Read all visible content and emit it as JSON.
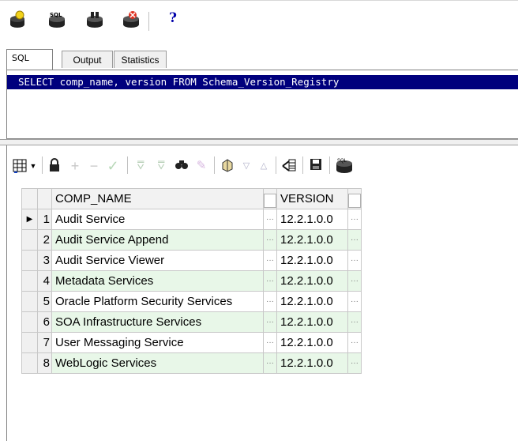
{
  "toolbar": {
    "icons": [
      "connect-icon",
      "sql-icon",
      "execute-icon",
      "disconnect-icon",
      "help-icon"
    ],
    "help_label": "?"
  },
  "tabs": [
    {
      "label": "SQL",
      "active": true
    },
    {
      "label": "Output",
      "active": false
    },
    {
      "label": "Statistics",
      "active": false
    }
  ],
  "editor": {
    "sql": "SELECT comp_name, version  FROM Schema_Version_Registry",
    "selection_color": "#00007d"
  },
  "grid_toolbar": {
    "icons": [
      "grid-view-icon",
      "dropdown-arrow-icon",
      "lock-icon",
      "add-row-icon",
      "delete-row-icon",
      "post-icon",
      "filter-icon",
      "filter-all-icon",
      "find-icon",
      "clear-icon",
      "navigator-icon",
      "sort-desc-icon",
      "sort-asc-icon",
      "export-icon",
      "save-icon",
      "db-icon"
    ]
  },
  "grid": {
    "columns": [
      "COMP_NAME",
      "VERSION"
    ],
    "rows": [
      {
        "n": "1",
        "comp_name": "Audit Service",
        "version": "12.2.1.0.0"
      },
      {
        "n": "2",
        "comp_name": "Audit Service Append",
        "version": "12.2.1.0.0"
      },
      {
        "n": "3",
        "comp_name": "Audit Service Viewer",
        "version": "12.2.1.0.0"
      },
      {
        "n": "4",
        "comp_name": "Metadata Services",
        "version": "12.2.1.0.0"
      },
      {
        "n": "5",
        "comp_name": "Oracle Platform Security Services",
        "version": "12.2.1.0.0"
      },
      {
        "n": "6",
        "comp_name": "SOA Infrastructure Services",
        "version": "12.2.1.0.0"
      },
      {
        "n": "7",
        "comp_name": "User Messaging Service",
        "version": "12.2.1.0.0"
      },
      {
        "n": "8",
        "comp_name": "WebLogic Services",
        "version": "12.2.1.0.0"
      }
    ],
    "current_row": 1,
    "ellipsis": "···",
    "row_alt_color": "#e8f7e8"
  }
}
